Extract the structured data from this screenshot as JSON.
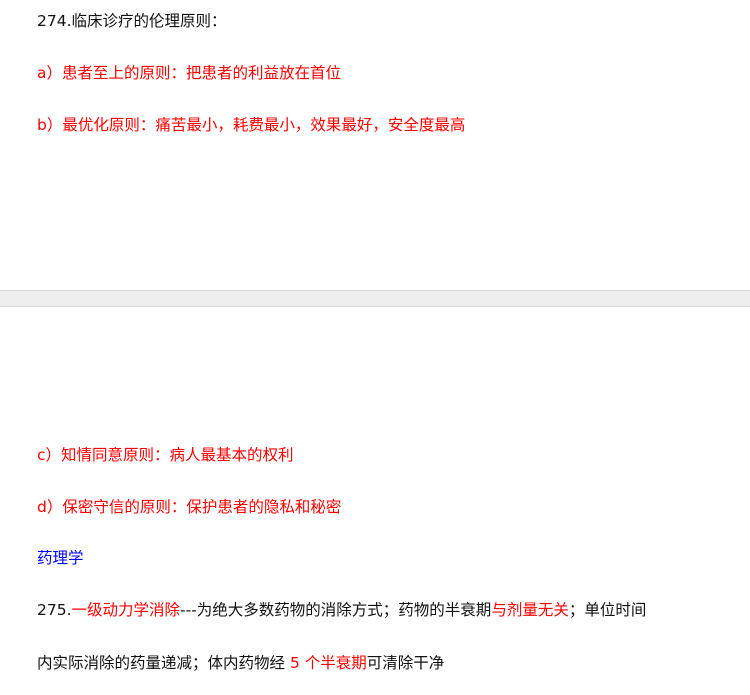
{
  "colors": {
    "text": "#111111",
    "highlight_red": "#ff0000",
    "heading_blue": "#0000ff",
    "page_gap": "#eeeeee"
  },
  "page1": {
    "q274_title": "274.临床诊疗的伦理原则：",
    "item_a": "a）患者至上的原则：把患者的利益放在首位",
    "item_b": "b）最优化原则：痛苦最小，耗费最小，效果最好，安全度最高"
  },
  "page2": {
    "item_c": "c）知情同意原则：病人最基本的权利",
    "item_d": "d）保密守信的原则：保护患者的隐私和秘密",
    "section_heading": "药理学",
    "q275": {
      "number": "275.",
      "term": "一级动力学消除",
      "text1": "---为绝大多数药物的消除方式；药物的半衰期",
      "highlight1": "与剂量无关",
      "text2": "；单位时间",
      "line2_text1": "内实际消除的药量递减；体内药物经 ",
      "line2_highlight": "5 个半衰期",
      "line2_text2": "可清除干净"
    }
  }
}
